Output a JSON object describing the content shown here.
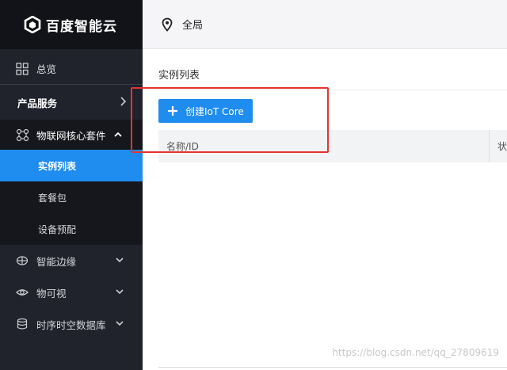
{
  "brand": {
    "name": "百度智能云"
  },
  "sidebar": {
    "overview": "总览",
    "products": "产品服务",
    "iot_suite": "物联网核心套件",
    "sub_items": [
      {
        "label": "实例列表",
        "active": true
      },
      {
        "label": "套餐包",
        "active": false
      },
      {
        "label": "设备预配",
        "active": false
      }
    ],
    "lower_items": [
      {
        "label": "智能边缘",
        "icon": "edge-icon"
      },
      {
        "label": "物可视",
        "icon": "eye-icon"
      },
      {
        "label": "时序时空数据库",
        "icon": "database-icon"
      }
    ]
  },
  "topbar": {
    "region": "全局"
  },
  "main": {
    "page_title": "实例列表",
    "create_button": "创建IoT Core",
    "table": {
      "columns": [
        "名称/ID",
        "状"
      ]
    }
  },
  "watermark": "https://blog.csdn.net/qq_27809619",
  "colors": {
    "sidebar_bg": "#21232c",
    "accent": "#1f8cf0",
    "highlight": "#e8322e"
  }
}
